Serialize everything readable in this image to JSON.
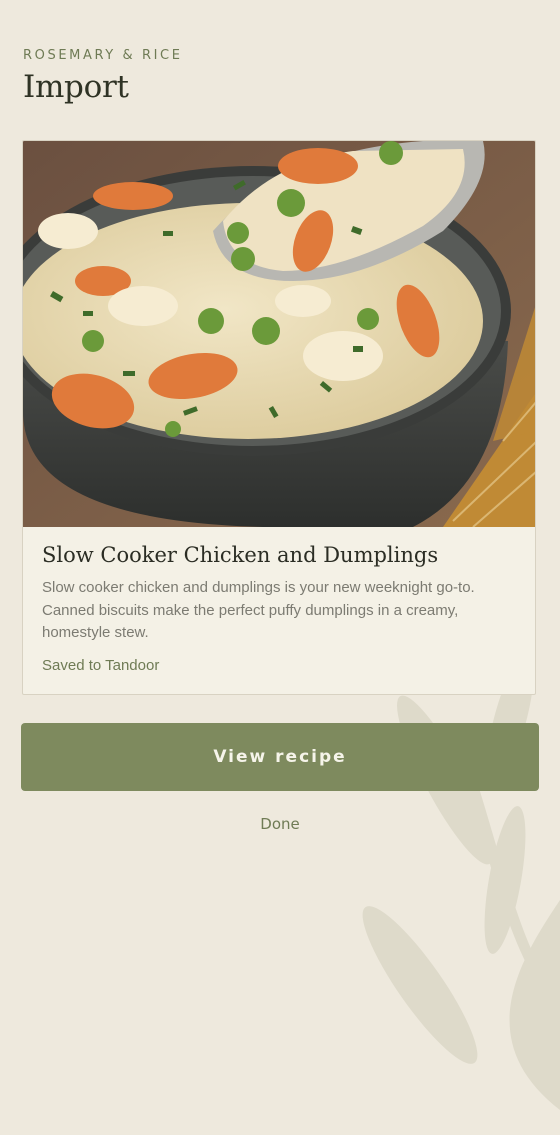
{
  "header": {
    "brand": "ROSEMARY & RICE",
    "title": "Import"
  },
  "recipe_card": {
    "image": "slow-cooker-chicken-and-dumplings-photo",
    "title": "Slow Cooker Chicken and Dumplings",
    "description_lines": [
      "Slow cooker chicken and dumplings is your new weeknight go-to.",
      "Canned biscuits make the perfect puffy dumplings in a creamy,",
      "homestyle stew."
    ],
    "status": "Saved to Tandoor"
  },
  "actions": {
    "primary_label": "View recipe",
    "secondary_label": "Done"
  },
  "colors": {
    "background": "#eee9dd",
    "accent": "#7e8a5e",
    "brand_text": "#6f7b55",
    "card": "#f4f1e6"
  }
}
